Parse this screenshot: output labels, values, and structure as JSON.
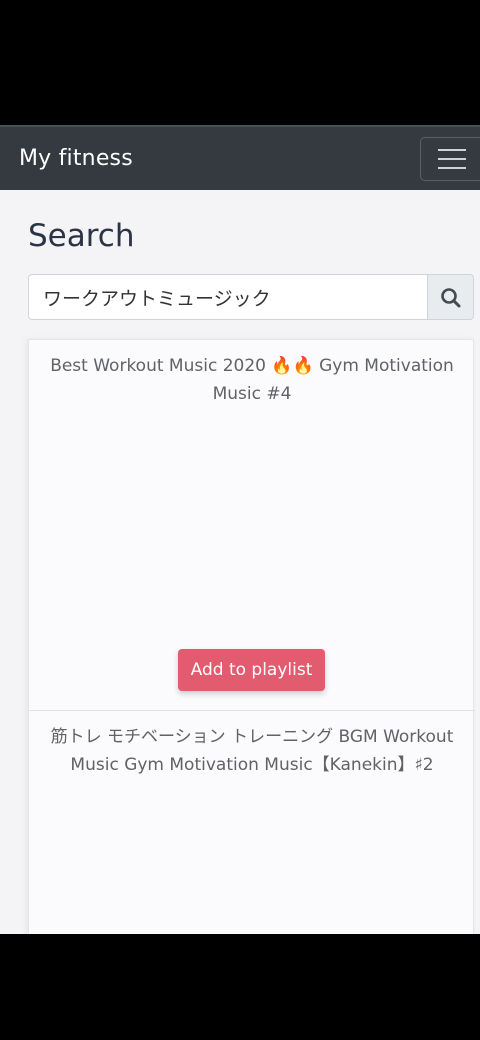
{
  "navbar": {
    "brand": "My fitness",
    "menu_icon": "hamburger-icon"
  },
  "page": {
    "title": "Search"
  },
  "search": {
    "value": "ワークアウトミュージック",
    "icon": "search-icon"
  },
  "results": [
    {
      "title": "Best Workout Music 2020 🔥🔥 Gym Motivation Music #4",
      "add_label": "Add to playlist"
    },
    {
      "title": "筋トレ モチベーション トレーニング BGM Workout Music Gym Motivation Music【Kanekin】♯2"
    }
  ],
  "colors": {
    "navbar": "#343a40",
    "accent": "#e25b6e",
    "background": "#f4f4f7"
  }
}
